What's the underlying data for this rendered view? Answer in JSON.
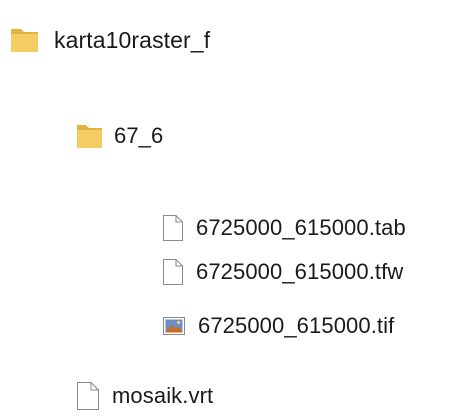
{
  "tree": {
    "root_folder": {
      "label": "karta10raster_f",
      "icon": "folder-icon"
    },
    "sub_folder": {
      "label": "67_6",
      "icon": "folder-icon"
    },
    "files": [
      {
        "label": "6725000_615000.tab",
        "icon": "file-icon"
      },
      {
        "label": "6725000_615000.tfw",
        "icon": "file-icon"
      },
      {
        "label": "6725000_615000.tif",
        "icon": "image-file-icon"
      }
    ],
    "root_file": {
      "label": "mosaik.vrt",
      "icon": "file-icon"
    }
  },
  "colors": {
    "folder": "#f4cd63",
    "folder_dark": "#e2b43f",
    "file_border": "#8a8a8a",
    "text": "#1a1a1a"
  }
}
